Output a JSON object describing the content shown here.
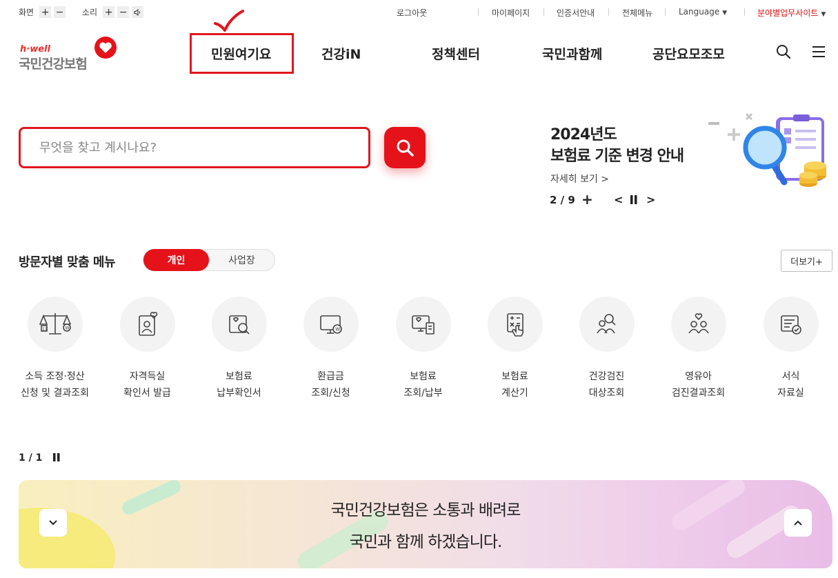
{
  "utility": {
    "screen_label": "화면",
    "sound_label": "소리",
    "plus": "+",
    "minus": "−",
    "links": [
      "로그아웃",
      "마이페이지",
      "인증서안내",
      "전체메뉴"
    ],
    "language": "Language",
    "field_sites": "분야별업무사이트"
  },
  "logo": {
    "tagline": "h·well",
    "name": "국민건강보험"
  },
  "gnb": {
    "items": [
      "민원여기요",
      "건강iN",
      "정책센터",
      "국민과함께",
      "공단요모조모"
    ]
  },
  "search": {
    "placeholder": "무엇을 찾고 계시나요?"
  },
  "banner": {
    "title_line1": "2024년도",
    "title_line2": "보험료 기준 변경 안내",
    "more": "자세히 보기 >",
    "pager": "2 / 9",
    "plus": "+",
    "prev": "<",
    "next": ">"
  },
  "custom_menu": {
    "title": "방문자별 맞춤 메뉴",
    "tabs": [
      "개인",
      "사업장"
    ],
    "more": "더보기+",
    "items": [
      {
        "line1": "소득 조정·정산",
        "line2": "신청 및 결과조회",
        "icon": "scale-icon"
      },
      {
        "line1": "자격득실",
        "line2": "확인서 발급",
        "icon": "id-card-heart-icon"
      },
      {
        "line1": "보험료",
        "line2": "납부확인서",
        "icon": "document-search-icon"
      },
      {
        "line1": "환급금",
        "line2": "조회/신청",
        "icon": "monitor-won-icon"
      },
      {
        "line1": "보험료",
        "line2": "조회/납부",
        "icon": "payment-terminal-icon"
      },
      {
        "line1": "보험료",
        "line2": "계산기",
        "icon": "calculator-icon"
      },
      {
        "line1": "건강검진",
        "line2": "대상조회",
        "icon": "people-search-icon"
      },
      {
        "line1": "영유아",
        "line2": "검진결과조회",
        "icon": "family-heart-icon"
      },
      {
        "line1": "서식",
        "line2": "자료실",
        "icon": "form-check-icon"
      }
    ],
    "pager": "1 / 1"
  },
  "strip": {
    "line1": "국민건강보험은 소통과 배려로",
    "line2": "국민과 함께 하겠습니다."
  },
  "colors": {
    "brand_red": "#e5121a",
    "highlight_red": "#e0161e"
  }
}
